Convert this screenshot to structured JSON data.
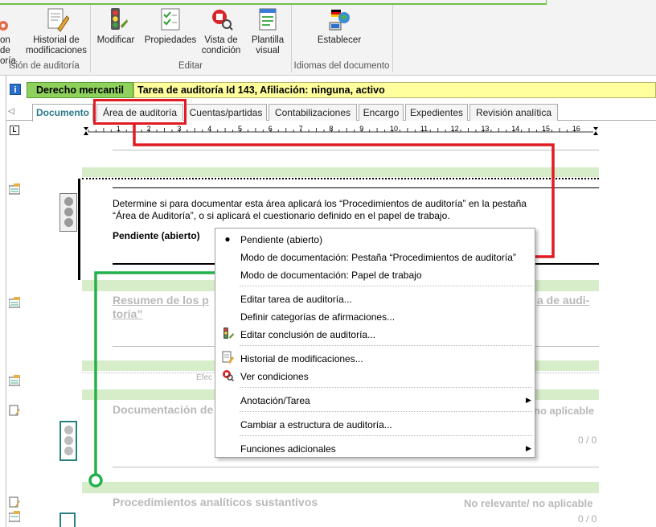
{
  "ribbon": {
    "partial_button_lines": [
      "on de",
      "oría"
    ],
    "historial_lines": [
      "Historial de",
      "modificaciones"
    ],
    "group_revision_label": "isión de auditoría",
    "modificar_label": "Modificar",
    "propiedades_label": "Propiedades",
    "vista_lines": [
      "Vista de",
      "condición"
    ],
    "plantilla_lines": [
      "Plantilla",
      "visual"
    ],
    "group_editar_label": "Editar",
    "establecer_label": "Establecer",
    "group_idiomas_label": "Idiomas del documento"
  },
  "header": {
    "info_label": "i",
    "category": "Derecho mercantil",
    "task_title": "Tarea de auditoría Id 143, Afiliación: ninguna, activo"
  },
  "tabs": [
    {
      "label": "Documento"
    },
    {
      "label": "Área de auditoría"
    },
    {
      "label": "Cuentas/partidas"
    },
    {
      "label": "Contabilizaciones"
    },
    {
      "label": "Encargo"
    },
    {
      "label": "Expedientes"
    },
    {
      "label": "Revisión analítica"
    }
  ],
  "ruler": {
    "corner_label": "L",
    "numbers": [
      "1",
      "2",
      "3",
      "4",
      "5",
      "6",
      "7",
      "8",
      "9",
      "10",
      "11",
      "12",
      "13",
      "14",
      "15",
      "16"
    ]
  },
  "document": {
    "paragraph_line1": "Determine si para documentar esta área aplicará los “Procedimientos de auditoría” en la pestaña",
    "paragraph_line2": "“Área de Auditoría”, o si aplicará el cuestionario definido en el papel de trabajo.",
    "status": "Pendiente (abierto)",
    "resumen_left": "Resumen de los p",
    "resumen_right": "a de audi-",
    "resumen_line2": "toría”",
    "efec_fragment": "Efec",
    "documentacion_left": "Documentación de",
    "documentacion_right": "no aplicable",
    "count_1": "0 / 0",
    "procedimientos_title": "Procedimientos analíticos sustantivos",
    "procedimientos_status": "No relevante/ no aplicable",
    "count_2": "0 / 0"
  },
  "context_menu": {
    "items": [
      {
        "label": "Pendiente (abierto)",
        "checked": true
      },
      {
        "label": "Modo de documentación: Pestaña “Procedimientos de auditoría”"
      },
      {
        "label": "Modo de documentación: Papel de trabajo"
      },
      {
        "label": "Editar tarea de auditoría..."
      },
      {
        "label": "Definir categorías de afirmaciones..."
      },
      {
        "label": "Editar conclusión de auditoría..."
      },
      {
        "label": "Historial de modificaciones..."
      },
      {
        "label": "Ver condiciones"
      },
      {
        "label": "Anotación/Tarea",
        "submenu": true
      },
      {
        "label": "Cambiar a estructura de auditoría..."
      },
      {
        "label": "Funciones adicionales",
        "submenu": true
      }
    ]
  },
  "colors": {
    "green_category": "#8fd15d",
    "task_yellow": "#ffff9e",
    "annotation_red": "#e01b24",
    "annotation_green": "#22b14c",
    "band_green": "#d7ecc8",
    "tab_active_text": "#2a7a8a"
  }
}
